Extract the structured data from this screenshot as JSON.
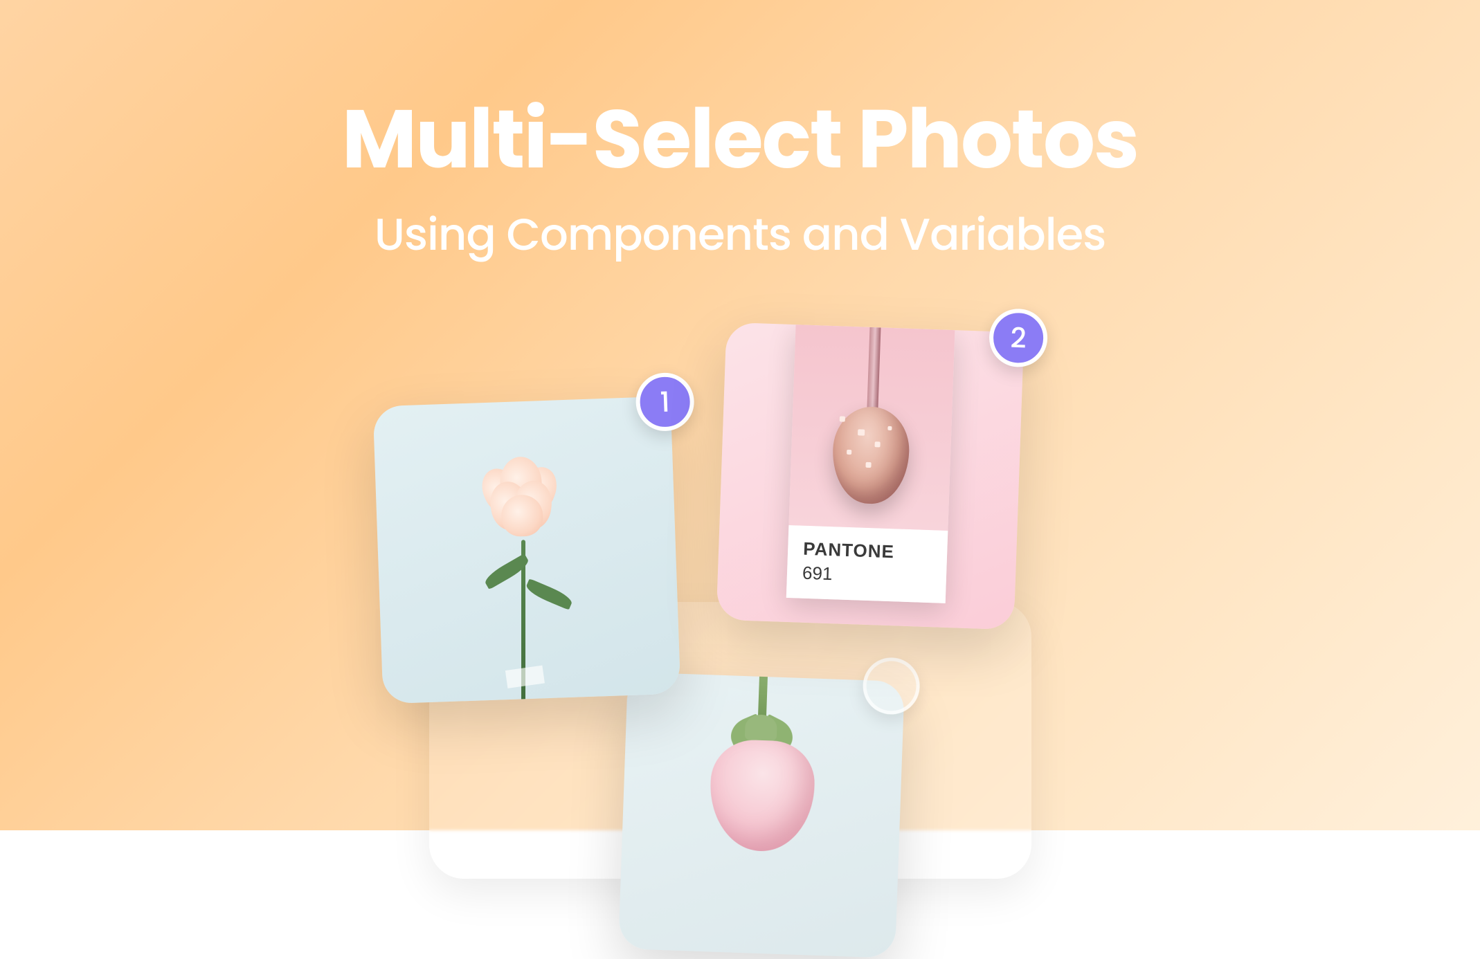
{
  "hero": {
    "title": "Multi-Select Photos",
    "subtitle": "Using Components and Variables"
  },
  "cards": [
    {
      "selected": true,
      "order": "1",
      "kind": "carnation_flower"
    },
    {
      "selected": true,
      "order": "2",
      "kind": "pantone_swatch",
      "pantone_label": "PANTONE",
      "pantone_code": "691"
    },
    {
      "selected": false,
      "order": "",
      "kind": "rose_flower"
    }
  ],
  "colors": {
    "badge_fill": "#8b7cf5",
    "badge_border": "#ffffff",
    "bg_gradient_from": "#ffd4a3",
    "bg_gradient_to": "#fff0db"
  }
}
